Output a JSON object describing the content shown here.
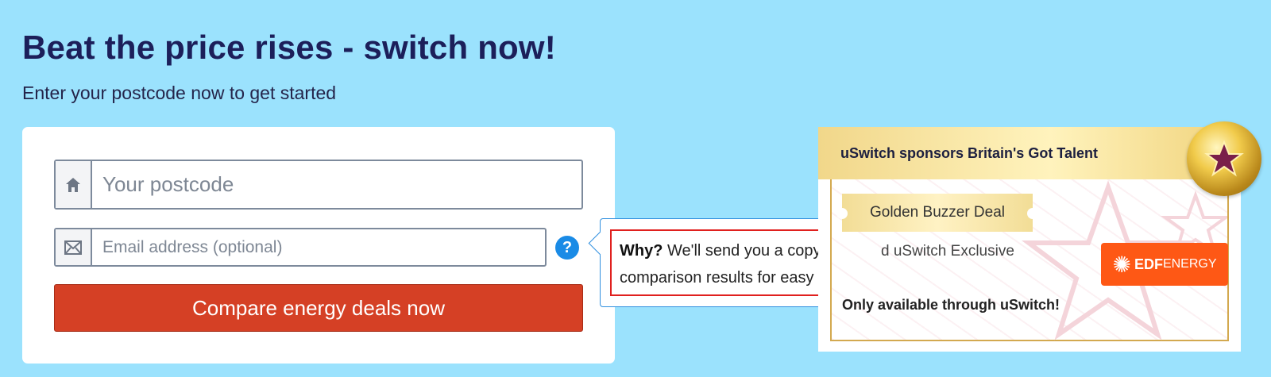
{
  "hero": {
    "headline": "Beat the price rises - switch now!",
    "subheadline": "Enter your postcode now to get started"
  },
  "form": {
    "postcode_placeholder": "Your postcode",
    "email_placeholder": "Email address (optional)",
    "help_label": "?",
    "submit_label": "Compare energy deals now",
    "icons": [
      "house-icon",
      "envelope-icon",
      "question-icon"
    ]
  },
  "tooltip": {
    "why_label": "Why?",
    "message_line1": "We'll send you a copy of your",
    "message_line2": "comparison results for easy reference"
  },
  "promo": {
    "header": "uSwitch sponsors Britain's Got Talent",
    "ribbon": "Golden Buzzer Deal",
    "exclusive_text": "d uSwitch Exclusive",
    "only_available": "Only available through uSwitch!",
    "brand_logo_text": "EDF",
    "brand_logo_sub": "ENERGY"
  },
  "colors": {
    "background": "#9be2fd",
    "headline": "#1c1f5a",
    "cta": "#d54025",
    "help": "#1a8be6",
    "tooltip_highlight": "#e0201e",
    "edf_orange": "#fe5815",
    "gold": "#f1cb4b"
  }
}
